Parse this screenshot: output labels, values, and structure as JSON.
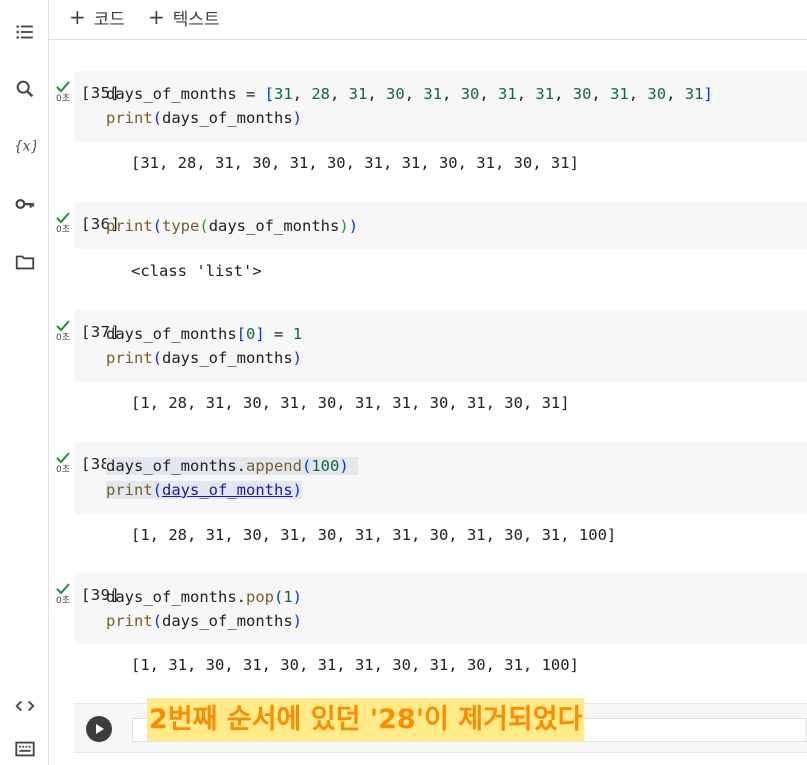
{
  "toolbar": {
    "add_code_label": "코드",
    "add_text_label": "텍스트"
  },
  "sidebar": {
    "icons": [
      "toc-icon",
      "search-icon",
      "variables-icon",
      "key-icon",
      "folder-icon",
      "code-icon",
      "terminal-icon"
    ]
  },
  "cells": [
    {
      "exec_count": "[35]",
      "time": "0초",
      "code_lines": [
        "days_of_months = [31, 28, 31, 30, 31, 30, 31, 31, 30, 31, 30, 31]",
        "print(days_of_months)"
      ],
      "output": "[31, 28, 31, 30, 31, 30, 31, 31, 30, 31, 30, 31]"
    },
    {
      "exec_count": "[36]",
      "time": "0초",
      "code_lines": [
        "print(type(days_of_months))"
      ],
      "output": "<class 'list'>"
    },
    {
      "exec_count": "[37]",
      "time": "0초",
      "code_lines": [
        "days_of_months[0] = 1",
        "print(days_of_months)"
      ],
      "output": "[1, 28, 31, 30, 31, 30, 31, 31, 30, 31, 30, 31]"
    },
    {
      "exec_count": "[38]",
      "time": "0초",
      "code_lines": [
        "days_of_months.append(100)",
        "print(days_of_months)"
      ],
      "output": "[1, 28, 31, 30, 31, 30, 31, 31, 30, 31, 30, 31, 100]"
    },
    {
      "exec_count": "[39]",
      "time": "0초",
      "code_lines": [
        "days_of_months.pop(1)",
        "print(days_of_months)"
      ],
      "output": "[1, 31, 30, 31, 30, 31, 31, 30, 31, 30, 31, 100]"
    }
  ],
  "annotation": "2번째 순서에 있던 '28'이 제거되었다",
  "colors": {
    "number": "#116644",
    "function": "#795e26",
    "bracket": "#0431fa",
    "annotation_text": "#ff8c00",
    "annotation_bg": "#ffeb88",
    "check": "#1e8e3e"
  }
}
